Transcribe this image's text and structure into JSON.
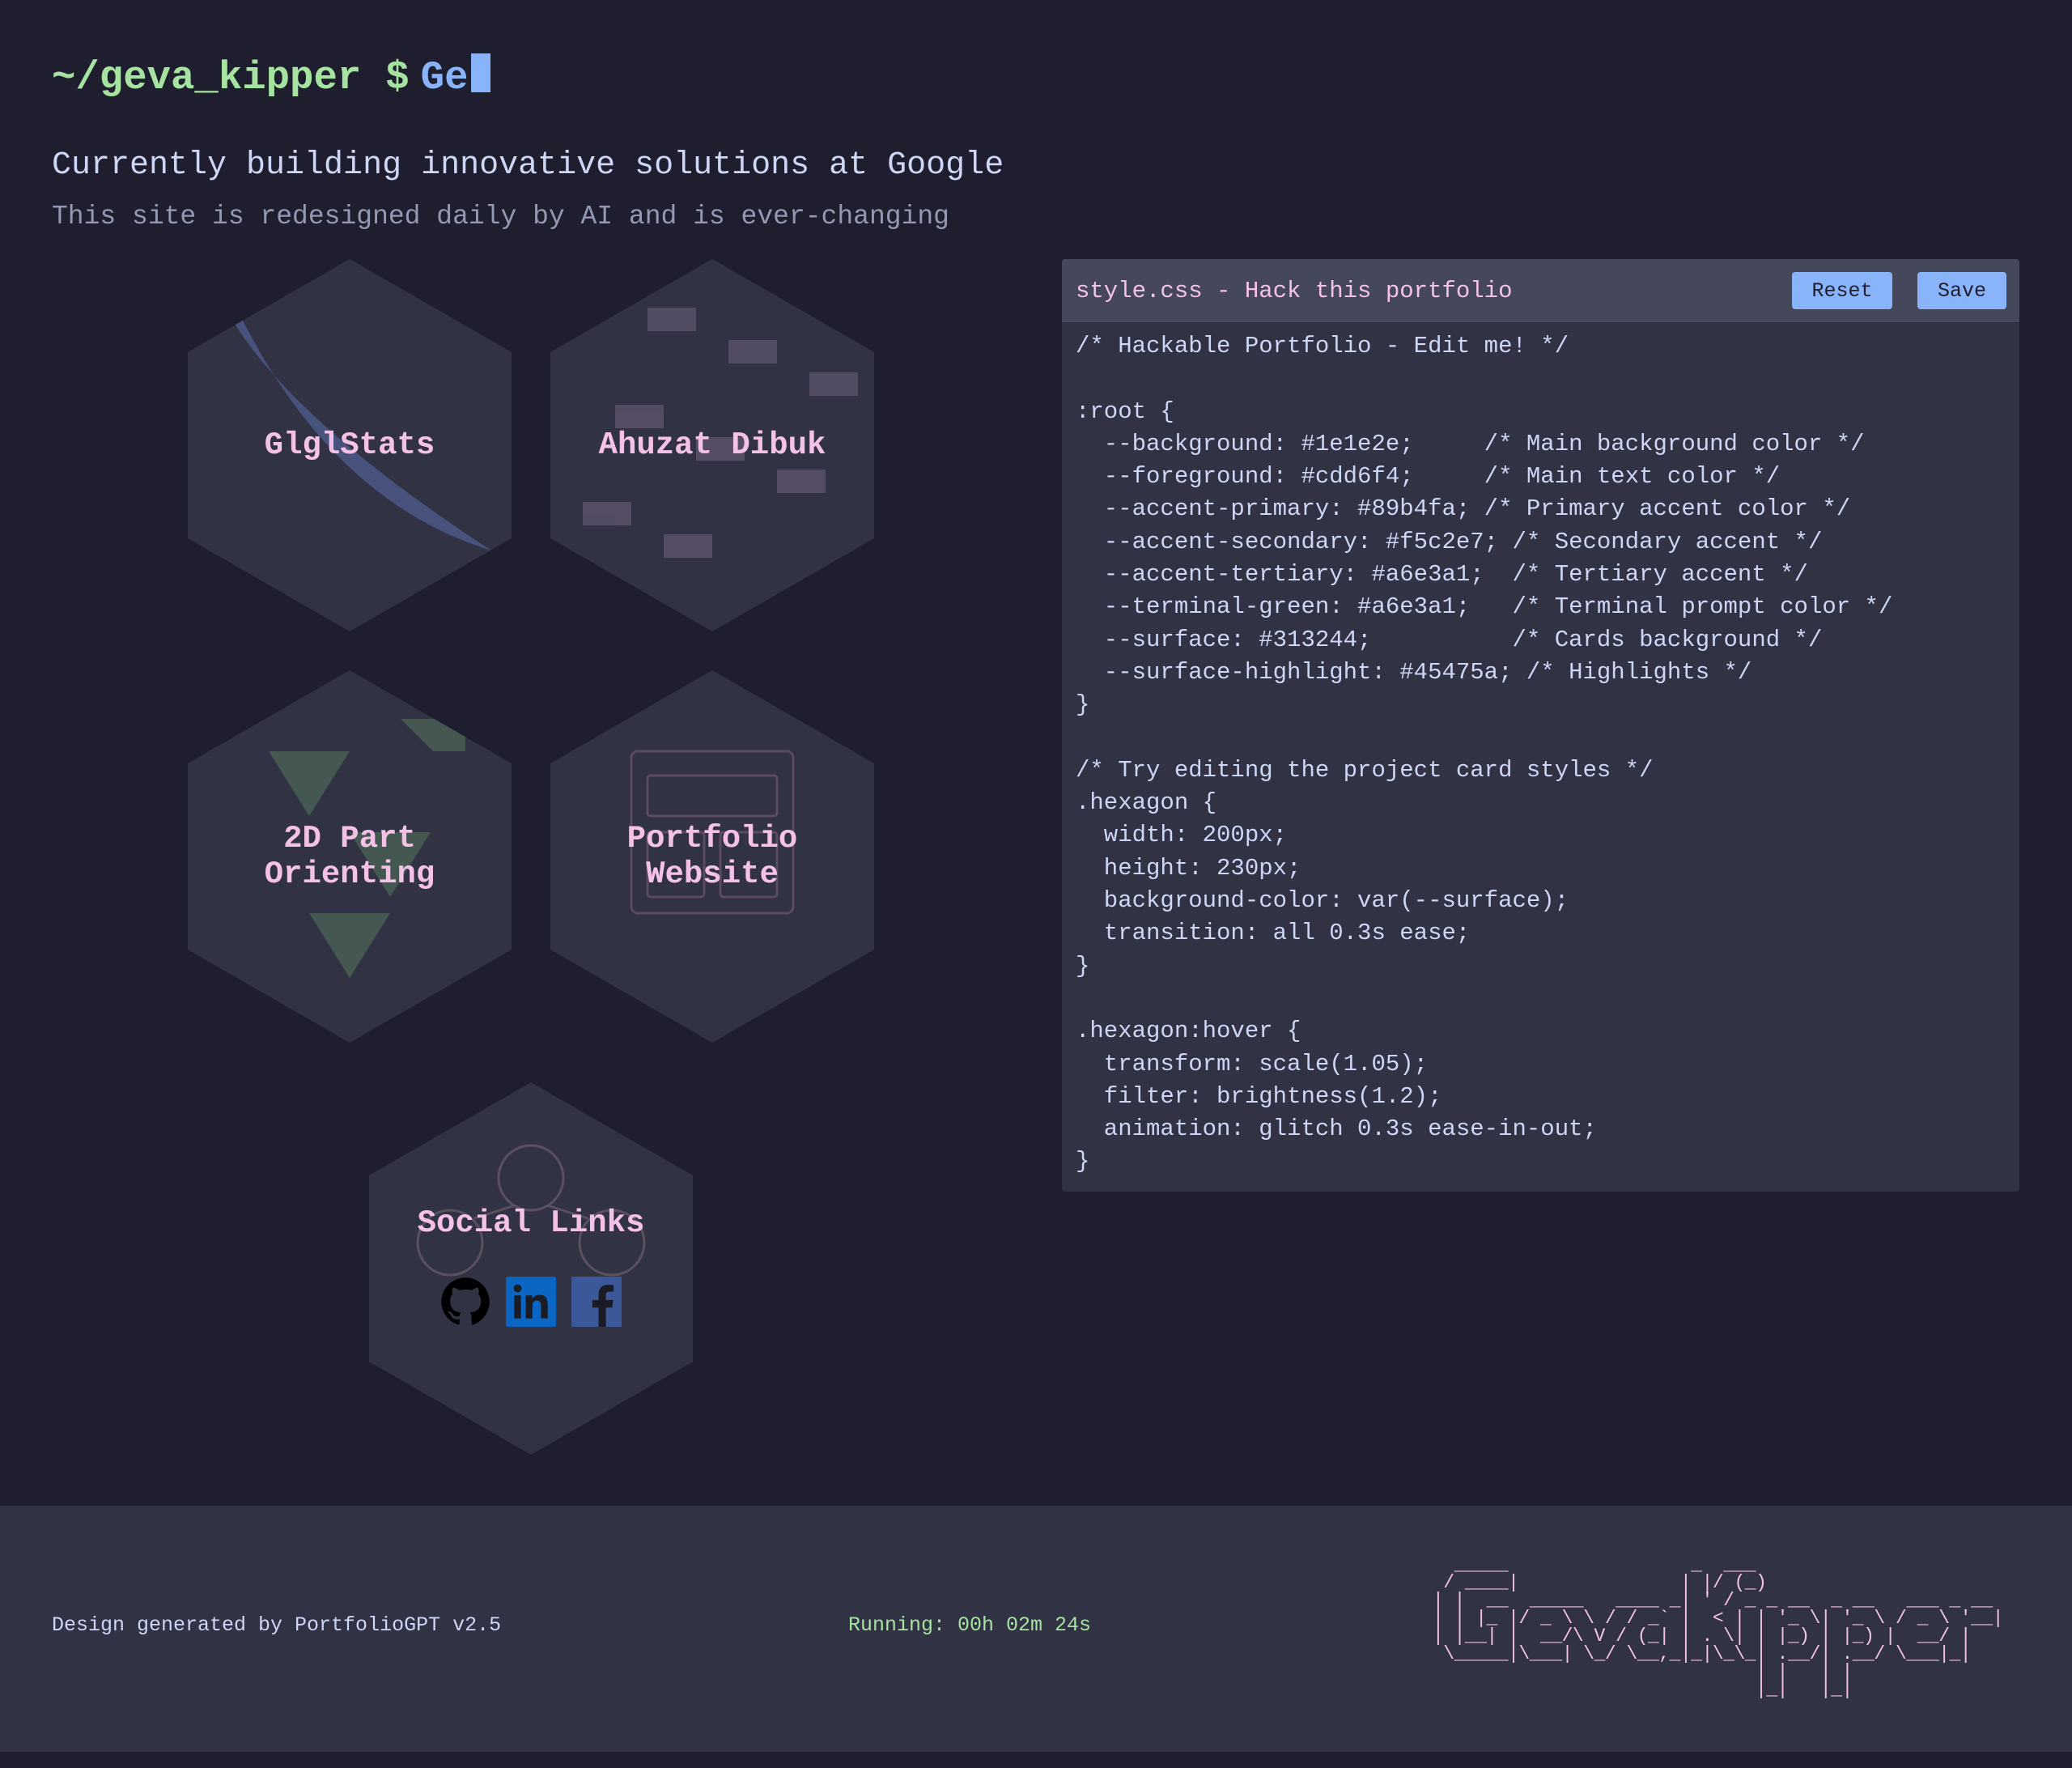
{
  "colors": {
    "background": "#1e1e2e",
    "foreground": "#cdd6f4",
    "accent_primary": "#89b4fa",
    "accent_secondary": "#f5c2e7",
    "accent_tertiary": "#a6e3a1",
    "surface": "#313244",
    "surface_highlight": "#45475a"
  },
  "header": {
    "prompt_path": "~/geva_kipper",
    "prompt_symbol": "$",
    "typed_text": "Ge",
    "tagline": "Currently building innovative solutions at Google",
    "subtitle": "This site is redesigned daily by AI and is ever-changing"
  },
  "projects": [
    {
      "title": "GlglStats"
    },
    {
      "title": "Ahuzat Dibuk"
    },
    {
      "title": "2D Part\nOrienting"
    },
    {
      "title": "Portfolio\nWebsite"
    }
  ],
  "social": {
    "title": "Social Links",
    "icons": [
      "github-icon",
      "linkedin-icon",
      "facebook-icon"
    ]
  },
  "editor": {
    "title": "style.css - Hack this portfolio",
    "reset_label": "Reset",
    "save_label": "Save",
    "code": "/* Hackable Portfolio - Edit me! */\n\n:root {\n  --background: #1e1e2e;     /* Main background color */\n  --foreground: #cdd6f4;     /* Main text color */\n  --accent-primary: #89b4fa; /* Primary accent color */\n  --accent-secondary: #f5c2e7; /* Secondary accent */\n  --accent-tertiary: #a6e3a1;  /* Tertiary accent */\n  --terminal-green: #a6e3a1;   /* Terminal prompt color */\n  --surface: #313244;          /* Cards background */\n  --surface-highlight: #45475a; /* Highlights */\n}\n\n/* Try editing the project card styles */\n.hexagon {\n  width: 200px;\n  height: 230px;\n  background-color: var(--surface);\n  transition: all 0.3s ease;\n}\n\n.hexagon:hover {\n  transform: scale(1.05);\n  filter: brightness(1.2);\n  animation: glitch 0.3s ease-in-out;\n}"
  },
  "footer": {
    "credit": "Design generated by PortfolioGPT v2.5",
    "running": "Running: 00h 02m 24s",
    "ascii_art": "  _____                 _  ___                       \n / ____|               | |/ (_)                      \n| |  __  _____   ____ _| ' / _ _ __  _ __   ___ _ __ \n| | |_ |/ _ \\ \\ / / _` |  < | | '_ \\| '_ \\ / _ \\ '__|\n| |__| |  __/\\ V / (_| | . \\| | |_) | |_) |  __/ |   \n \\_____|\\___| \\_/ \\__,_|_|\\_\\_| .__/| .__/ \\___|_|   \n                              | |   | |              \n                              |_|   |_|              "
  }
}
